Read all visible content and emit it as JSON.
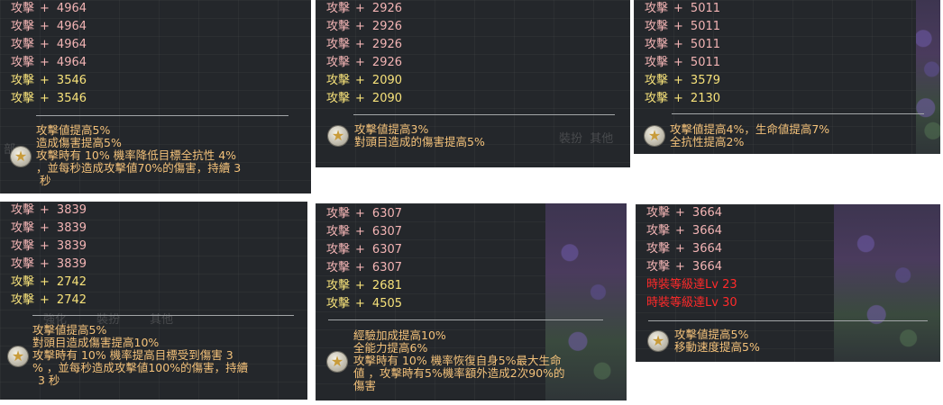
{
  "panels": [
    {
      "stats": [
        {
          "label": "攻擊",
          "sign": "+",
          "value": "4964",
          "color": "pink"
        },
        {
          "label": "攻擊",
          "sign": "+",
          "value": "4964",
          "color": "pink"
        },
        {
          "label": "攻擊",
          "sign": "+",
          "value": "4964",
          "color": "pink"
        },
        {
          "label": "攻擊",
          "sign": "+",
          "value": "4964",
          "color": "pink"
        },
        {
          "label": "攻擊",
          "sign": "+",
          "value": "3546",
          "color": "yellow"
        },
        {
          "label": "攻擊",
          "sign": "+",
          "value": "3546",
          "color": "yellow"
        }
      ],
      "effects": [
        "攻擊値提高5%",
        "造成傷害提高5%",
        "攻擊時有 10% 機率降低目標全抗性 4%",
        "，並每秒造成攻擊値70%的傷害，持續 3",
        "秒"
      ]
    },
    {
      "stats": [
        {
          "label": "攻擊",
          "sign": "+",
          "value": "2926",
          "color": "pink"
        },
        {
          "label": "攻擊",
          "sign": "+",
          "value": "2926",
          "color": "pink"
        },
        {
          "label": "攻擊",
          "sign": "+",
          "value": "2926",
          "color": "pink"
        },
        {
          "label": "攻擊",
          "sign": "+",
          "value": "2926",
          "color": "pink"
        },
        {
          "label": "攻擊",
          "sign": "+",
          "value": "2090",
          "color": "yellow"
        },
        {
          "label": "攻擊",
          "sign": "+",
          "value": "2090",
          "color": "yellow"
        }
      ],
      "effects": [
        "攻擊値提高3%",
        "對頭目造成的傷害提高5%"
      ],
      "ghost_tabs": [
        "裝扮",
        "其他"
      ]
    },
    {
      "stats": [
        {
          "label": "攻擊",
          "sign": "+",
          "value": "5011",
          "color": "pink"
        },
        {
          "label": "攻擊",
          "sign": "+",
          "value": "5011",
          "color": "pink"
        },
        {
          "label": "攻擊",
          "sign": "+",
          "value": "5011",
          "color": "pink"
        },
        {
          "label": "攻擊",
          "sign": "+",
          "value": "5011",
          "color": "pink"
        },
        {
          "label": "攻擊",
          "sign": "+",
          "value": "3579",
          "color": "yellow"
        },
        {
          "label": "攻擊",
          "sign": "+",
          "value": "2130",
          "color": "yellow"
        }
      ],
      "effects": [
        "攻擊値提高4%，生命値提高7%",
        "全抗性提高2%"
      ]
    },
    {
      "stats": [
        {
          "label": "攻擊",
          "sign": "+",
          "value": "3839",
          "color": "pink"
        },
        {
          "label": "攻擊",
          "sign": "+",
          "value": "3839",
          "color": "pink"
        },
        {
          "label": "攻擊",
          "sign": "+",
          "value": "3839",
          "color": "pink"
        },
        {
          "label": "攻擊",
          "sign": "+",
          "value": "3839",
          "color": "pink"
        },
        {
          "label": "攻擊",
          "sign": "+",
          "value": "2742",
          "color": "yellow"
        },
        {
          "label": "攻擊",
          "sign": "+",
          "value": "2742",
          "color": "yellow"
        }
      ],
      "effects": [
        "攻擊値提高5%",
        "對頭目造成傷害提高10%",
        "攻擊時有 10% 機率提高目標受到傷害 3",
        "% ，並每秒造成攻擊値100%的傷害，持續",
        "3 秒"
      ],
      "ghost_tabs": [
        "強化",
        "裝扮",
        "其他"
      ]
    },
    {
      "stats": [
        {
          "label": "攻擊",
          "sign": "+",
          "value": "6307",
          "color": "pink"
        },
        {
          "label": "攻擊",
          "sign": "+",
          "value": "6307",
          "color": "pink"
        },
        {
          "label": "攻擊",
          "sign": "+",
          "value": "6307",
          "color": "pink"
        },
        {
          "label": "攻擊",
          "sign": "+",
          "value": "6307",
          "color": "pink"
        },
        {
          "label": "攻擊",
          "sign": "+",
          "value": "2681",
          "color": "yellow"
        },
        {
          "label": "攻擊",
          "sign": "+",
          "value": "4505",
          "color": "yellow"
        }
      ],
      "effects": [
        "經驗加成提高10%",
        "全能力提高6%",
        "攻擊時有 10% 機率恢復自身5%最大生命",
        "値 ，攻擊時有5%機率額外造成2次90%的",
        "傷害"
      ]
    },
    {
      "stats": [
        {
          "label": "攻擊",
          "sign": "+",
          "value": "3664",
          "color": "pink"
        },
        {
          "label": "攻擊",
          "sign": "+",
          "value": "3664",
          "color": "pink"
        },
        {
          "label": "攻擊",
          "sign": "+",
          "value": "3664",
          "color": "pink"
        },
        {
          "label": "攻擊",
          "sign": "+",
          "value": "3664",
          "color": "pink"
        },
        {
          "label": "時裝等級達Lv",
          "sign": "",
          "value": "23",
          "color": "red"
        },
        {
          "label": "時裝等級達Lv",
          "sign": "",
          "value": "30",
          "color": "red"
        }
      ],
      "effects": [
        "攻擊値提高5%",
        "移動速度提高5%"
      ]
    }
  ],
  "icons": {
    "set_effect": "star-icon"
  },
  "colors": {
    "pink": "#f3b4b4",
    "yellow": "#f7e27a",
    "red": "#ff2a2a",
    "effect": "#f4c27a",
    "panel_bg": "#24272b"
  }
}
